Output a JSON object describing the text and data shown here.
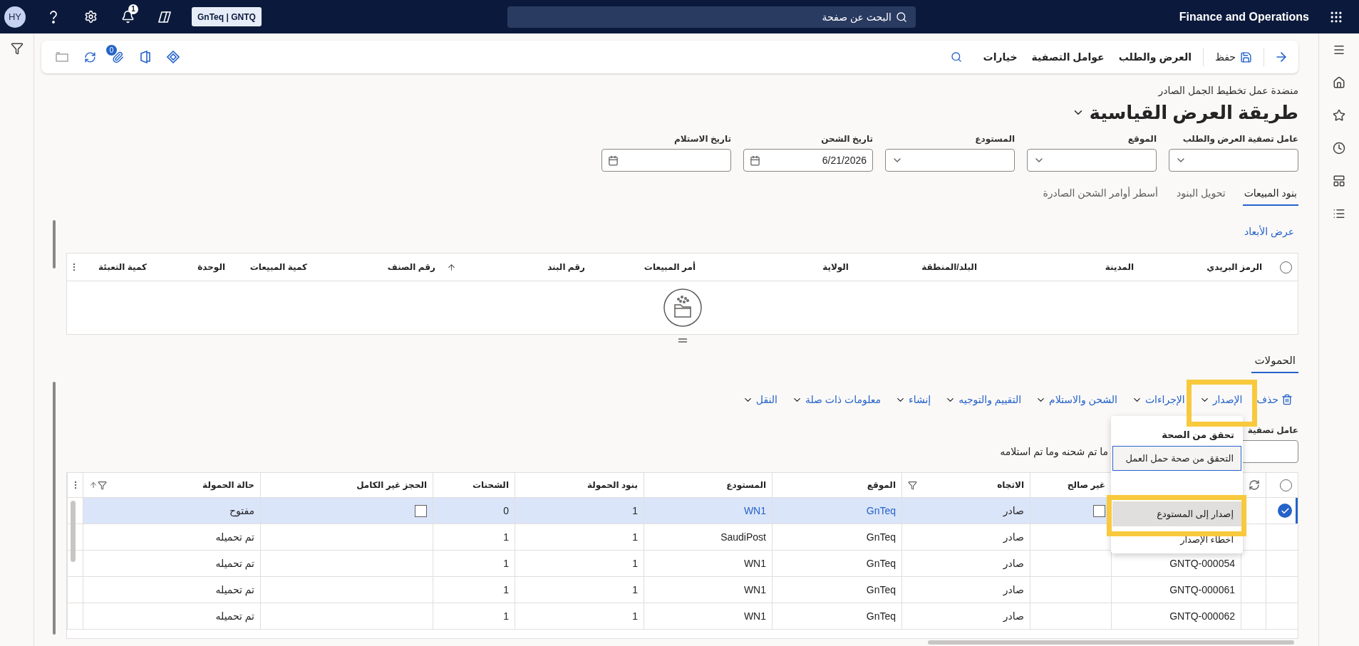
{
  "nav_bar": {
    "avatar": "HY",
    "notification_count": "1",
    "company": "GnTeq | GNTQ",
    "search": {
      "placeholder": "البحث عن صفحة"
    },
    "app_title": "Finance and Operations"
  },
  "action_pane": {
    "commands": [
      "حفظ",
      "العرض والطلب",
      "عوامل التصفية",
      "خيارات"
    ],
    "attachment_count": "0"
  },
  "page": {
    "caption": "منضدة عمل تخطيط الجمل الصادر",
    "view_title": "طريقة العرض القياسية"
  },
  "filters": [
    {
      "label": "عامل تصفية العرض والطلب",
      "kind": "dropdown"
    },
    {
      "label": "الموقع",
      "kind": "dropdown"
    },
    {
      "label": "المستودع",
      "kind": "dropdown"
    },
    {
      "label": "تاريخ الشحن",
      "kind": "date",
      "value": "6/21/2026"
    },
    {
      "label": "تاريخ الاستلام",
      "kind": "date"
    }
  ],
  "tabs": [
    {
      "label": "بنود المبيعات",
      "selected": true
    },
    {
      "label": "تحويل البنود",
      "selected": false
    },
    {
      "label": "أسطر أوامر الشحن الصادرة",
      "selected": false
    }
  ],
  "dimensions_link": "عرض الأبعاد",
  "lines_grid": {
    "all_selected": false,
    "columns": [
      {
        "label": "الرمز البريدي",
        "sorted": false
      },
      {
        "label": "المدينة",
        "sorted": false
      },
      {
        "label": "البلد/المنطقة",
        "sorted": false
      },
      {
        "label": "الولاية",
        "sorted": false
      },
      {
        "label": "أمر المبيعات",
        "sorted": false
      },
      {
        "label": "رقم البند",
        "sorted": true
      },
      {
        "label": "رقم الصنف",
        "sorted": false
      },
      {
        "label": "كمية المبيعات",
        "sorted": false
      },
      {
        "label": "الوحدة",
        "sorted": false
      },
      {
        "label": "كمية التعبئة",
        "sorted": false
      }
    ]
  },
  "loads": {
    "title": "الحمولات",
    "actions": [
      {
        "label": "حذف",
        "kind": "delete"
      },
      {
        "label": "الإصدار",
        "kind": "menu"
      },
      {
        "label": "الإجراءات",
        "kind": "menu"
      },
      {
        "label": "الشحن والاستلام",
        "kind": "menu"
      },
      {
        "label": "التقييم والتوجيه",
        "kind": "menu"
      },
      {
        "label": "إنشاء",
        "kind": "menu"
      },
      {
        "label": "معلومات ذات صلة",
        "kind": "menu"
      },
      {
        "label": "النقل",
        "kind": "menu"
      }
    ],
    "filter_label": "عامل تصفية",
    "all_selected": false,
    "show_option": "ما تم شحنه وما تم استلامه",
    "columns": [
      {
        "label": "غير صالح",
        "filtered": false,
        "sorted": false
      },
      {
        "label": "الاتجاه",
        "filtered": true,
        "sorted": false
      },
      {
        "label": "الموقع",
        "filtered": false,
        "sorted": false
      },
      {
        "label": "المستودع",
        "filtered": false,
        "sorted": false
      },
      {
        "label": "بنود الحمولة",
        "filtered": false,
        "sorted": false
      },
      {
        "label": "الشحنات",
        "filtered": false,
        "sorted": false
      },
      {
        "label": "الحجز غير الكامل",
        "filtered": false,
        "sorted": false
      },
      {
        "label": "حالة الحمولة",
        "filtered": true,
        "sorted": true
      }
    ],
    "rows": [
      {
        "selected": true,
        "invalid_checked": false,
        "direction": "صادر",
        "site": "GnTeq",
        "warehouse": "WN1",
        "load_lines": "1",
        "shipments": "0",
        "partial_reservation_checked": false,
        "status": "مفتوح"
      },
      {
        "selected": false,
        "direction": "صادر",
        "site": "GnTeq",
        "warehouse": "SaudiPost",
        "load_lines": "1",
        "shipments": "1",
        "status": "تم تحميله"
      },
      {
        "selected": false,
        "load_id": "GNTQ-000054",
        "direction": "صادر",
        "site": "GnTeq",
        "warehouse": "WN1",
        "load_lines": "1",
        "shipments": "1",
        "status": "تم تحميله"
      },
      {
        "selected": false,
        "load_id": "GNTQ-000061",
        "direction": "صادر",
        "site": "GnTeq",
        "warehouse": "WN1",
        "load_lines": "1",
        "shipments": "1",
        "status": "تم تحميله"
      },
      {
        "selected": false,
        "load_id": "GNTQ-000062",
        "direction": "صادر",
        "site": "GnTeq",
        "warehouse": "WN1",
        "load_lines": "1",
        "shipments": "1",
        "status": "تم تحميله"
      }
    ]
  },
  "release_menu": {
    "groups": [
      {
        "title": "تحقق من الصحة",
        "items": [
          {
            "label": "التحقق من صحة حمل العمل",
            "focused": true,
            "hovered": false
          }
        ]
      },
      {
        "items": [
          {
            "label": "إصدار إلى المستودع",
            "focused": false,
            "hovered": true
          },
          {
            "label": "اخطاء الإصدار",
            "focused": false,
            "hovered": false
          }
        ]
      }
    ]
  }
}
